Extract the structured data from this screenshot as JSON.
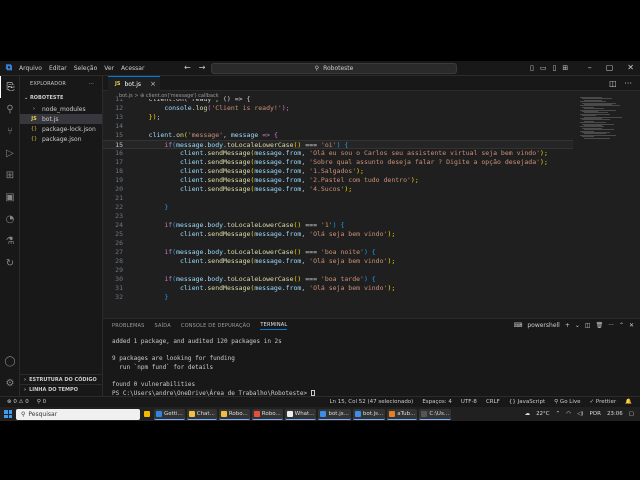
{
  "menu": [
    "Arquivo",
    "Editar",
    "Seleção",
    "Ver",
    "Acessar"
  ],
  "command_center": "Roboteste",
  "sidebar": {
    "title": "EXPLORADOR",
    "project": "ROBOTESTE",
    "items": [
      {
        "label": "node_modules",
        "icon": "chevron-right",
        "kind": "folder"
      },
      {
        "label": "bot.js",
        "icon": "JS",
        "kind": "js"
      },
      {
        "label": "package-lock.json",
        "icon": "{}",
        "kind": "json"
      },
      {
        "label": "package.json",
        "icon": "{}",
        "kind": "json"
      }
    ],
    "outline": "ESTRUTURA DO CÓDIGO",
    "timeline": "LINHA DO TEMPO"
  },
  "tab": {
    "icon": "JS",
    "label": "bot.js",
    "close": "×"
  },
  "breadcrumb": "bot.js > ⊕ client.on('message') callback",
  "code_lines": [
    {
      "n": "11",
      "tokens": [
        [
          "    client.on('ready', () => {",
          "pl"
        ]
      ]
    },
    {
      "n": "12",
      "tokens": [
        [
          "        ",
          "pl"
        ],
        [
          "console",
          "var"
        ],
        [
          ".",
          "pl"
        ],
        [
          "log",
          "fn"
        ],
        [
          "(",
          "br2"
        ],
        [
          "'Client is ready!'",
          "str"
        ],
        [
          ");",
          "br2"
        ]
      ]
    },
    {
      "n": "13",
      "tokens": [
        [
          "    ",
          "pl"
        ],
        [
          "})",
          "br"
        ],
        [
          ";",
          "pl"
        ]
      ]
    },
    {
      "n": "14",
      "tokens": []
    },
    {
      "n": "15",
      "tokens": [
        [
          "    ",
          "pl"
        ],
        [
          "client",
          "var"
        ],
        [
          ".",
          "pl"
        ],
        [
          "on",
          "fn"
        ],
        [
          "(",
          "br"
        ],
        [
          "'message'",
          "str"
        ],
        [
          ", ",
          "pl"
        ],
        [
          "message",
          "var"
        ],
        [
          " => ",
          "kw"
        ],
        [
          "{",
          "br2"
        ]
      ]
    },
    {
      "n": "15",
      "current": true,
      "tokens": [
        [
          "        ",
          "pl"
        ],
        [
          "if",
          "kw"
        ],
        [
          "(",
          "br3"
        ],
        [
          "message",
          "var"
        ],
        [
          ".",
          "pl"
        ],
        [
          "body",
          "var"
        ],
        [
          ".",
          "pl"
        ],
        [
          "toLocaleLowerCase",
          "fn"
        ],
        [
          "()",
          "br"
        ],
        [
          " === ",
          "op"
        ],
        [
          "'oi'",
          "str"
        ],
        [
          ") {",
          "br3"
        ]
      ]
    },
    {
      "n": "16",
      "tokens": [
        [
          "            ",
          "pl"
        ],
        [
          "client",
          "var"
        ],
        [
          ".",
          "pl"
        ],
        [
          "sendMessage",
          "fn"
        ],
        [
          "(",
          "br"
        ],
        [
          "message",
          "var"
        ],
        [
          ".",
          "pl"
        ],
        [
          "from",
          "var"
        ],
        [
          ", ",
          "pl"
        ],
        [
          "'Olá eu sou o Carlos seu assistente virtual seja bem vindo'",
          "str"
        ],
        [
          ");",
          "br"
        ]
      ]
    },
    {
      "n": "17",
      "tokens": [
        [
          "            ",
          "pl"
        ],
        [
          "client",
          "var"
        ],
        [
          ".",
          "pl"
        ],
        [
          "sendMessage",
          "fn"
        ],
        [
          "(",
          "br"
        ],
        [
          "message",
          "var"
        ],
        [
          ".",
          "pl"
        ],
        [
          "from",
          "var"
        ],
        [
          ", ",
          "pl"
        ],
        [
          "'Sobre qual assunto deseja falar ? Digite a opção desejada'",
          "str"
        ],
        [
          ");",
          "br"
        ]
      ]
    },
    {
      "n": "18",
      "tokens": [
        [
          "            ",
          "pl"
        ],
        [
          "client",
          "var"
        ],
        [
          ".",
          "pl"
        ],
        [
          "sendMessage",
          "fn"
        ],
        [
          "(",
          "br"
        ],
        [
          "message",
          "var"
        ],
        [
          ".",
          "pl"
        ],
        [
          "from",
          "var"
        ],
        [
          ", ",
          "pl"
        ],
        [
          "'1.Salgados'",
          "str"
        ],
        [
          ");",
          "br"
        ]
      ]
    },
    {
      "n": "19",
      "tokens": [
        [
          "            ",
          "pl"
        ],
        [
          "client",
          "var"
        ],
        [
          ".",
          "pl"
        ],
        [
          "sendMessage",
          "fn"
        ],
        [
          "(",
          "br"
        ],
        [
          "message",
          "var"
        ],
        [
          ".",
          "pl"
        ],
        [
          "from",
          "var"
        ],
        [
          ", ",
          "pl"
        ],
        [
          "'2.Pastel com tudo dentro'",
          "str"
        ],
        [
          ");",
          "br"
        ]
      ]
    },
    {
      "n": "20",
      "tokens": [
        [
          "            ",
          "pl"
        ],
        [
          "client",
          "var"
        ],
        [
          ".",
          "pl"
        ],
        [
          "sendMessage",
          "fn"
        ],
        [
          "(",
          "br"
        ],
        [
          "message",
          "var"
        ],
        [
          ".",
          "pl"
        ],
        [
          "from",
          "var"
        ],
        [
          ", ",
          "pl"
        ],
        [
          "'4.Sucos'",
          "str"
        ],
        [
          ");",
          "br"
        ]
      ]
    },
    {
      "n": "21",
      "tokens": []
    },
    {
      "n": "22",
      "tokens": [
        [
          "        ",
          "pl"
        ],
        [
          "}",
          "br3"
        ]
      ]
    },
    {
      "n": "23",
      "tokens": []
    },
    {
      "n": "24",
      "tokens": [
        [
          "        ",
          "pl"
        ],
        [
          "if",
          "kw"
        ],
        [
          "(",
          "br3"
        ],
        [
          "message",
          "var"
        ],
        [
          ".",
          "pl"
        ],
        [
          "body",
          "var"
        ],
        [
          ".",
          "pl"
        ],
        [
          "toLocaleLowerCase",
          "fn"
        ],
        [
          "()",
          "br"
        ],
        [
          " === ",
          "op"
        ],
        [
          "'1'",
          "str"
        ],
        [
          ") {",
          "br3"
        ]
      ]
    },
    {
      "n": "25",
      "tokens": [
        [
          "            ",
          "pl"
        ],
        [
          "client",
          "var"
        ],
        [
          ".",
          "pl"
        ],
        [
          "sendMessage",
          "fn"
        ],
        [
          "(",
          "br"
        ],
        [
          "message",
          "var"
        ],
        [
          ".",
          "pl"
        ],
        [
          "from",
          "var"
        ],
        [
          ", ",
          "pl"
        ],
        [
          "'Olá seja bem vindo'",
          "str"
        ],
        [
          ");",
          "br"
        ]
      ]
    },
    {
      "n": "26",
      "tokens": []
    },
    {
      "n": "27",
      "tokens": [
        [
          "        ",
          "pl"
        ],
        [
          "if",
          "kw"
        ],
        [
          "(",
          "br3"
        ],
        [
          "message",
          "var"
        ],
        [
          ".",
          "pl"
        ],
        [
          "body",
          "var"
        ],
        [
          ".",
          "pl"
        ],
        [
          "toLocaleLowerCase",
          "fn"
        ],
        [
          "()",
          "br"
        ],
        [
          " === ",
          "op"
        ],
        [
          "'boa noite'",
          "str"
        ],
        [
          ") {",
          "br3"
        ]
      ]
    },
    {
      "n": "28",
      "tokens": [
        [
          "            ",
          "pl"
        ],
        [
          "client",
          "var"
        ],
        [
          ".",
          "pl"
        ],
        [
          "sendMessage",
          "fn"
        ],
        [
          "(",
          "br"
        ],
        [
          "message",
          "var"
        ],
        [
          ".",
          "pl"
        ],
        [
          "from",
          "var"
        ],
        [
          ", ",
          "pl"
        ],
        [
          "'Olá seja bem vindo'",
          "str"
        ],
        [
          ");",
          "br"
        ]
      ]
    },
    {
      "n": "29",
      "tokens": []
    },
    {
      "n": "30",
      "tokens": [
        [
          "        ",
          "pl"
        ],
        [
          "if",
          "kw"
        ],
        [
          "(",
          "br3"
        ],
        [
          "message",
          "var"
        ],
        [
          ".",
          "pl"
        ],
        [
          "body",
          "var"
        ],
        [
          ".",
          "pl"
        ],
        [
          "toLocaleLowerCase",
          "fn"
        ],
        [
          "()",
          "br"
        ],
        [
          " === ",
          "op"
        ],
        [
          "'boa tarde'",
          "str"
        ],
        [
          ") {",
          "br3"
        ]
      ]
    },
    {
      "n": "31",
      "tokens": [
        [
          "            ",
          "pl"
        ],
        [
          "client",
          "var"
        ],
        [
          ".",
          "pl"
        ],
        [
          "sendMessage",
          "fn"
        ],
        [
          "(",
          "br"
        ],
        [
          "message",
          "var"
        ],
        [
          ".",
          "pl"
        ],
        [
          "from",
          "var"
        ],
        [
          ", ",
          "pl"
        ],
        [
          "'Olá seja bem vindo'",
          "str"
        ],
        [
          ");",
          "br"
        ]
      ]
    },
    {
      "n": "32",
      "tokens": [
        [
          "        ",
          "pl"
        ],
        [
          "}",
          "br3"
        ]
      ]
    }
  ],
  "panel": {
    "tabs": [
      "PROBLEMAS",
      "SAÍDA",
      "CONSOLE DE DEPURAÇÃO",
      "TERMINAL"
    ],
    "active_tab": "TERMINAL",
    "shell": "powershell",
    "terminal_lines": [
      "added 1 package, and audited 120 packages in 2s",
      "",
      "9 packages are looking for funding",
      "  run `npm fund` for details",
      "",
      "found 0 vulnerabilities",
      "PS C:\\Users\\andre\\OneDrive\\Área de Trabalho\\Roboteste> "
    ]
  },
  "status": {
    "left": [
      "⊗ 0 ⚠ 0",
      "⚲ 0"
    ],
    "right": [
      "Ln 15, Col 52 (47 selecionado)",
      "Espaços: 4",
      "UTF-8",
      "CRLF",
      "{} JavaScript",
      "⚲ Go Live",
      "✓ Prettier",
      "🔔"
    ]
  },
  "taskbar": {
    "search": "Pesquisar",
    "apps": [
      {
        "label": "",
        "color": "#f5b800",
        "running": false
      },
      {
        "label": "Getti...",
        "color": "#2e86de",
        "running": true
      },
      {
        "label": "Chat...",
        "color": "#f0c040",
        "running": true
      },
      {
        "label": "Robo...",
        "color": "#f0c040",
        "running": true
      },
      {
        "label": "Robo...",
        "color": "#e74c3c",
        "running": true
      },
      {
        "label": "What...",
        "color": "#eeeeee",
        "running": true
      },
      {
        "label": "bot.js...",
        "color": "#3b8eea",
        "running": true
      },
      {
        "label": "bot.js...",
        "color": "#3b8eea",
        "running": true
      },
      {
        "label": "aTub...",
        "color": "#e67e22",
        "running": true
      },
      {
        "label": "C:\\Us...",
        "color": "#555555",
        "running": true
      }
    ],
    "temp": "22°C",
    "lang": "POR",
    "time": "23:06"
  },
  "colors": {
    "accent": "#0078d4",
    "editor_bg": "#1f1f1f"
  }
}
